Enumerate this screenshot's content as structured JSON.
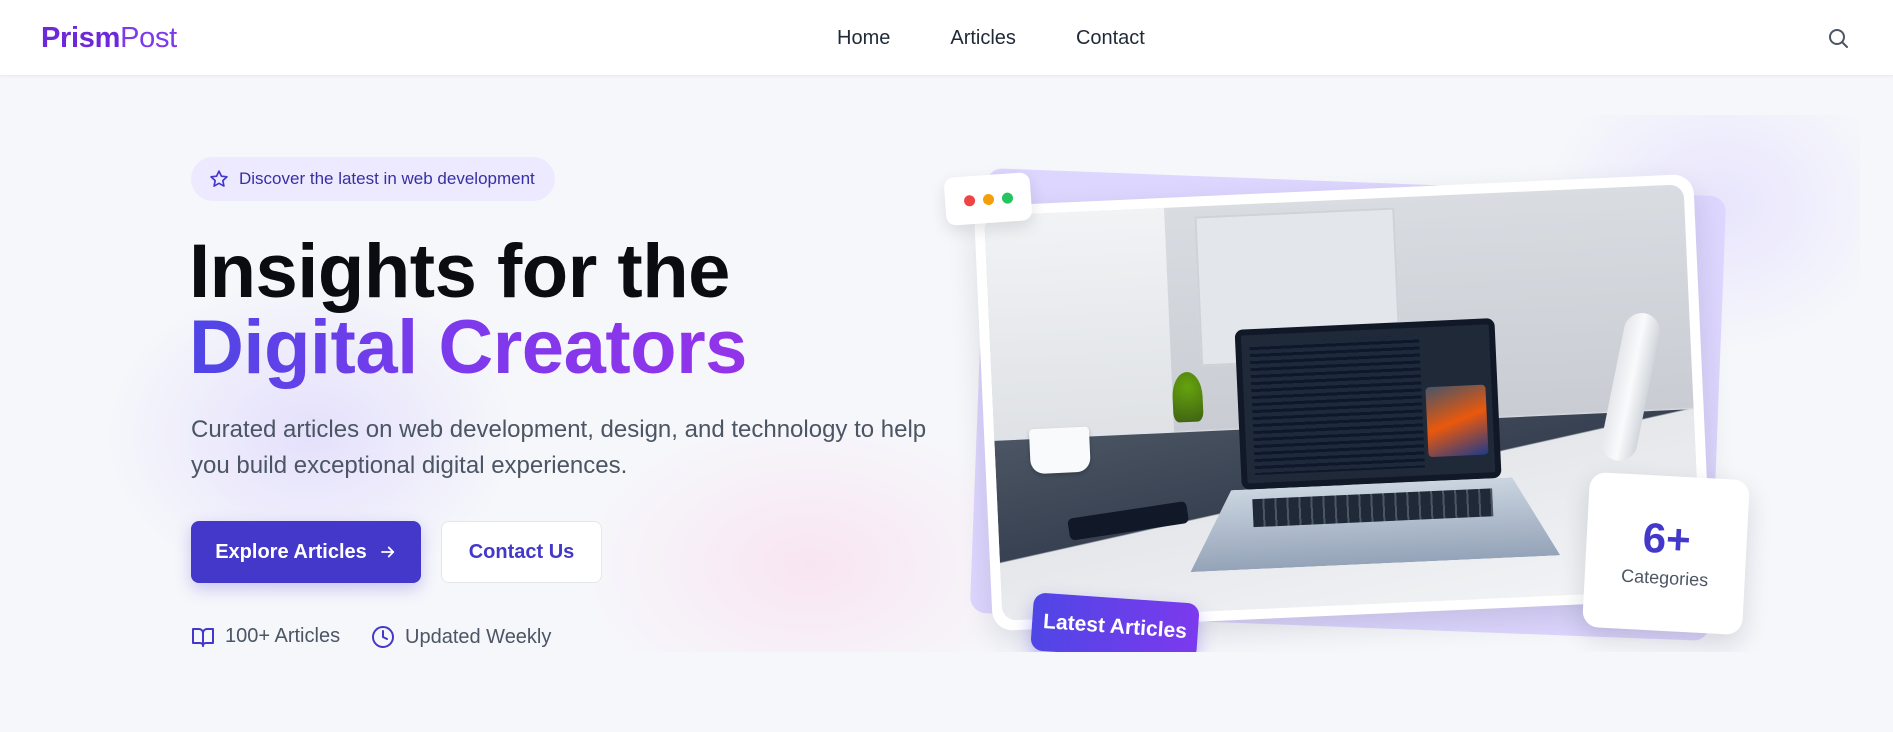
{
  "header": {
    "logo_bold": "Prism",
    "logo_light": "Post",
    "nav": [
      {
        "label": "Home"
      },
      {
        "label": "Articles"
      },
      {
        "label": "Contact"
      }
    ],
    "search_icon": "search-icon"
  },
  "hero": {
    "pill_text": "Discover the latest in web development",
    "pill_icon": "star-icon",
    "title_line1": "Insights for the",
    "title_line2": "Digital Creators",
    "subtitle": "Curated articles on web development, design, and technology to help you build exceptional digital experiences.",
    "primary_button": "Explore Articles",
    "primary_icon": "arrow-right-icon",
    "secondary_button": "Contact Us",
    "stats": [
      {
        "icon": "book-icon",
        "label": "100+ Articles"
      },
      {
        "icon": "clock-icon",
        "label": "Updated Weekly"
      }
    ]
  },
  "image_card": {
    "window_dots": [
      "#ef4444",
      "#f59e0b",
      "#22c55e"
    ],
    "latest_badge": "Latest Articles",
    "categories_value": "6+",
    "categories_label": "Categories"
  },
  "colors": {
    "brand": "#6d28d9",
    "primary": "#4338ca",
    "gradient_start": "#4f46e5",
    "gradient_end": "#9333ea"
  }
}
